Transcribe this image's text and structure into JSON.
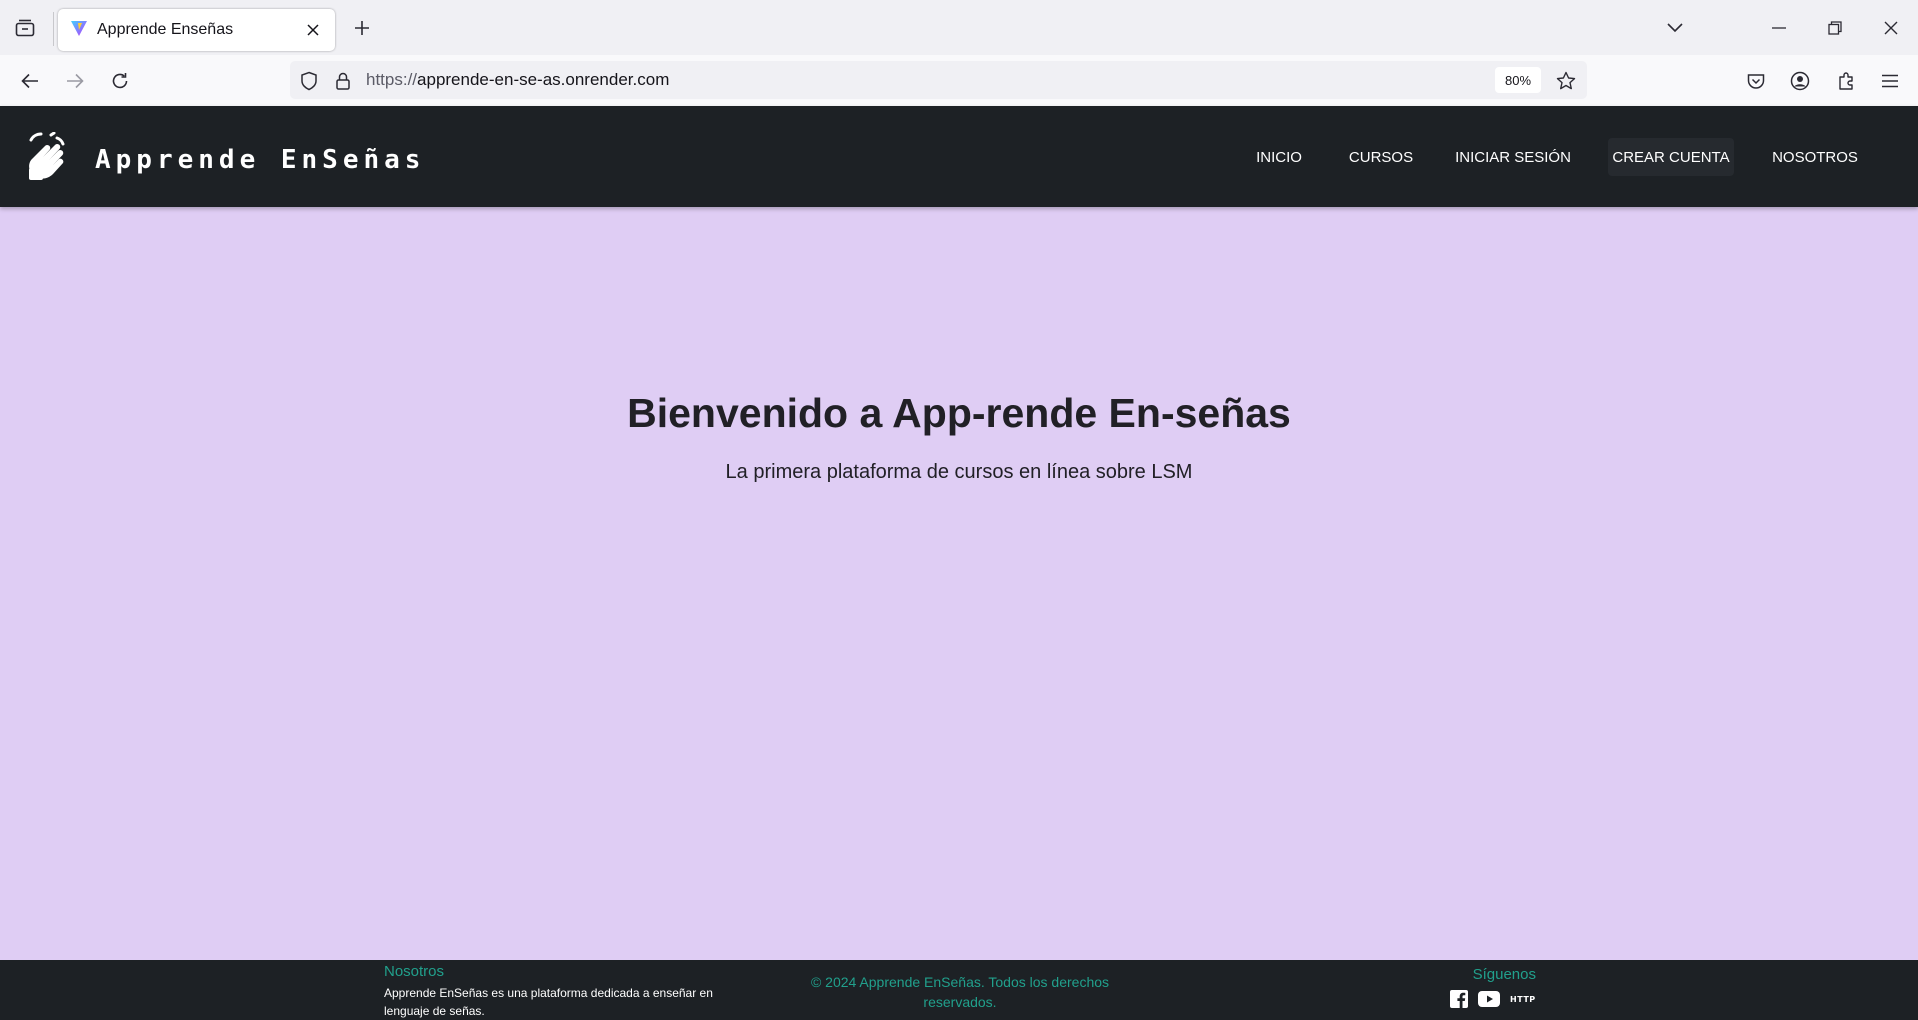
{
  "browser": {
    "tab": {
      "title": "Apprende Enseñas"
    },
    "url": {
      "scheme": "https://",
      "host": "apprende-en-se-as.onrender.com"
    },
    "zoom": "80%"
  },
  "site": {
    "brand": "Apprende EnSeñas",
    "nav": [
      {
        "label": "INICIO"
      },
      {
        "label": "CURSOS"
      },
      {
        "label": "INICIAR SESIÓN"
      },
      {
        "label": "CREAR CUENTA"
      },
      {
        "label": "NOSOTROS"
      }
    ],
    "hero": {
      "title": "Bienvenido a App-rende En-señas",
      "subtitle": "La primera plataforma de cursos en línea sobre LSM"
    },
    "footer": {
      "about_title": "Nosotros",
      "about_text": "Apprende EnSeñas es una plataforma dedicada a enseñar en lenguaje de señas.",
      "copyright": "© 2024 Apprende EnSeñas. Todos los derechos reservados.",
      "follow_title": "Síguenos",
      "social": {
        "http_label": "HTTP"
      }
    }
  },
  "colors": {
    "page_bg": "#dfcdf4",
    "header_bg": "#1d2125",
    "footer_accent": "#21a08c"
  },
  "icons": {
    "tabs_list": "tab-list-icon",
    "favicon": "vite-logo-icon",
    "logo": "waving-hand-sign-icon",
    "facebook": "facebook-icon",
    "youtube": "youtube-icon"
  }
}
